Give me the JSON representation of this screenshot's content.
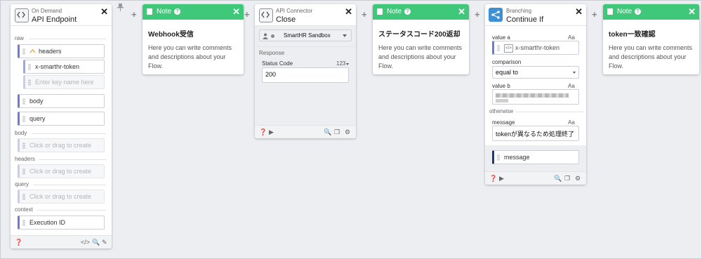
{
  "endpoint_card": {
    "subtitle": "On Demand",
    "title": "API Endpoint",
    "sections": {
      "raw": "raw",
      "body": "body",
      "headers": "headers",
      "query": "query",
      "context": "context"
    },
    "fields": {
      "headers": "headers",
      "x_smarthr_token": "x-smarthr-token",
      "enter_key": "Enter key name here",
      "body": "body",
      "query": "query",
      "drag_body": "Click or drag to create",
      "drag_headers": "Click or drag to create",
      "drag_query": "Click or drag to create",
      "execution_id": "Execution ID"
    }
  },
  "note1": {
    "header": "Note",
    "title": "Webhook受信",
    "desc": "Here you can write comments and descriptions about your Flow."
  },
  "api_card": {
    "subtitle": "API Connector",
    "title": "Close",
    "account": "SmartHR Sandbox",
    "response_label": "Response",
    "status_code_label": "Status Code",
    "type_badge": "123",
    "status_code_value": "200"
  },
  "note2": {
    "header": "Note",
    "title": "ステータスコード200返却",
    "desc": "Here you can write comments and descriptions about your Flow."
  },
  "branch_card": {
    "subtitle": "Branching",
    "title": "Continue If",
    "value_a_label": "value a",
    "value_a_aa": "Aa",
    "value_a_field": "x-smarthr-token",
    "comparison_label": "comparison",
    "comparison_value": "equal to",
    "value_b_label": "value b",
    "value_b_aa": "Aa",
    "otherwise_label": "otherwise",
    "message_label": "message",
    "message_aa": "Aa",
    "message_value": "tokenが異なるため処理終了",
    "output_field": "message"
  },
  "note3": {
    "header": "Note",
    "title": "token一致確認",
    "desc": "Here you can write comments and descriptions about your Flow."
  },
  "icons": {
    "accent_green": "#3fc77a",
    "field_blue": "#6f7bd3",
    "branch_blue": "#3d8fd6"
  }
}
